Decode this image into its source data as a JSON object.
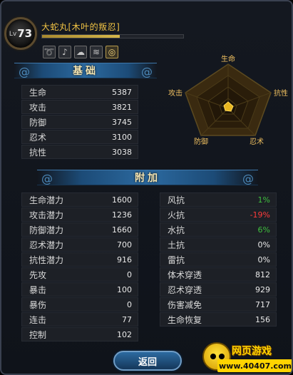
{
  "header": {
    "level_prefix": "Lv",
    "level": "73",
    "name": "大蛇丸[木叶的叛忍]",
    "name_bar_fill": 0.55,
    "skill_icons": [
      "swirl-icon",
      "music-note-icon",
      "cloud-icon",
      "wind-icon",
      "spiral-icon"
    ]
  },
  "basic": {
    "title": "基础",
    "stats": [
      {
        "label": "生命",
        "value": "5387"
      },
      {
        "label": "攻击",
        "value": "3821"
      },
      {
        "label": "防御",
        "value": "3745"
      },
      {
        "label": "忍术",
        "value": "3100"
      },
      {
        "label": "抗性",
        "value": "3038"
      }
    ]
  },
  "radar": {
    "labels": [
      "生命",
      "抗性",
      "忍术",
      "防御",
      "攻击"
    ]
  },
  "extra": {
    "title": "附加",
    "left": [
      {
        "label": "生命潜力",
        "value": "1600"
      },
      {
        "label": "攻击潜力",
        "value": "1236"
      },
      {
        "label": "防御潜力",
        "value": "1660"
      },
      {
        "label": "忍术潜力",
        "value": "700"
      },
      {
        "label": "抗性潜力",
        "value": "916"
      },
      {
        "label": "先攻",
        "value": "0"
      },
      {
        "label": "暴击",
        "value": "100"
      },
      {
        "label": "暴伤",
        "value": "0"
      },
      {
        "label": "连击",
        "value": "77"
      },
      {
        "label": "控制",
        "value": "102"
      }
    ],
    "right": [
      {
        "label": "风抗",
        "value": "1%"
      },
      {
        "label": "火抗",
        "value": "-19%"
      },
      {
        "label": "水抗",
        "value": "6%"
      },
      {
        "label": "土抗",
        "value": "0%"
      },
      {
        "label": "雷抗",
        "value": "0%"
      },
      {
        "label": "体术穿透",
        "value": "812"
      },
      {
        "label": "忍术穿透",
        "value": "929"
      },
      {
        "label": "伤害减免",
        "value": "717"
      },
      {
        "label": "生命恢复",
        "value": "156"
      }
    ]
  },
  "footer": {
    "return_label": "返回"
  },
  "watermark": {
    "text": "网页游戏",
    "url": "www.40407.com"
  }
}
